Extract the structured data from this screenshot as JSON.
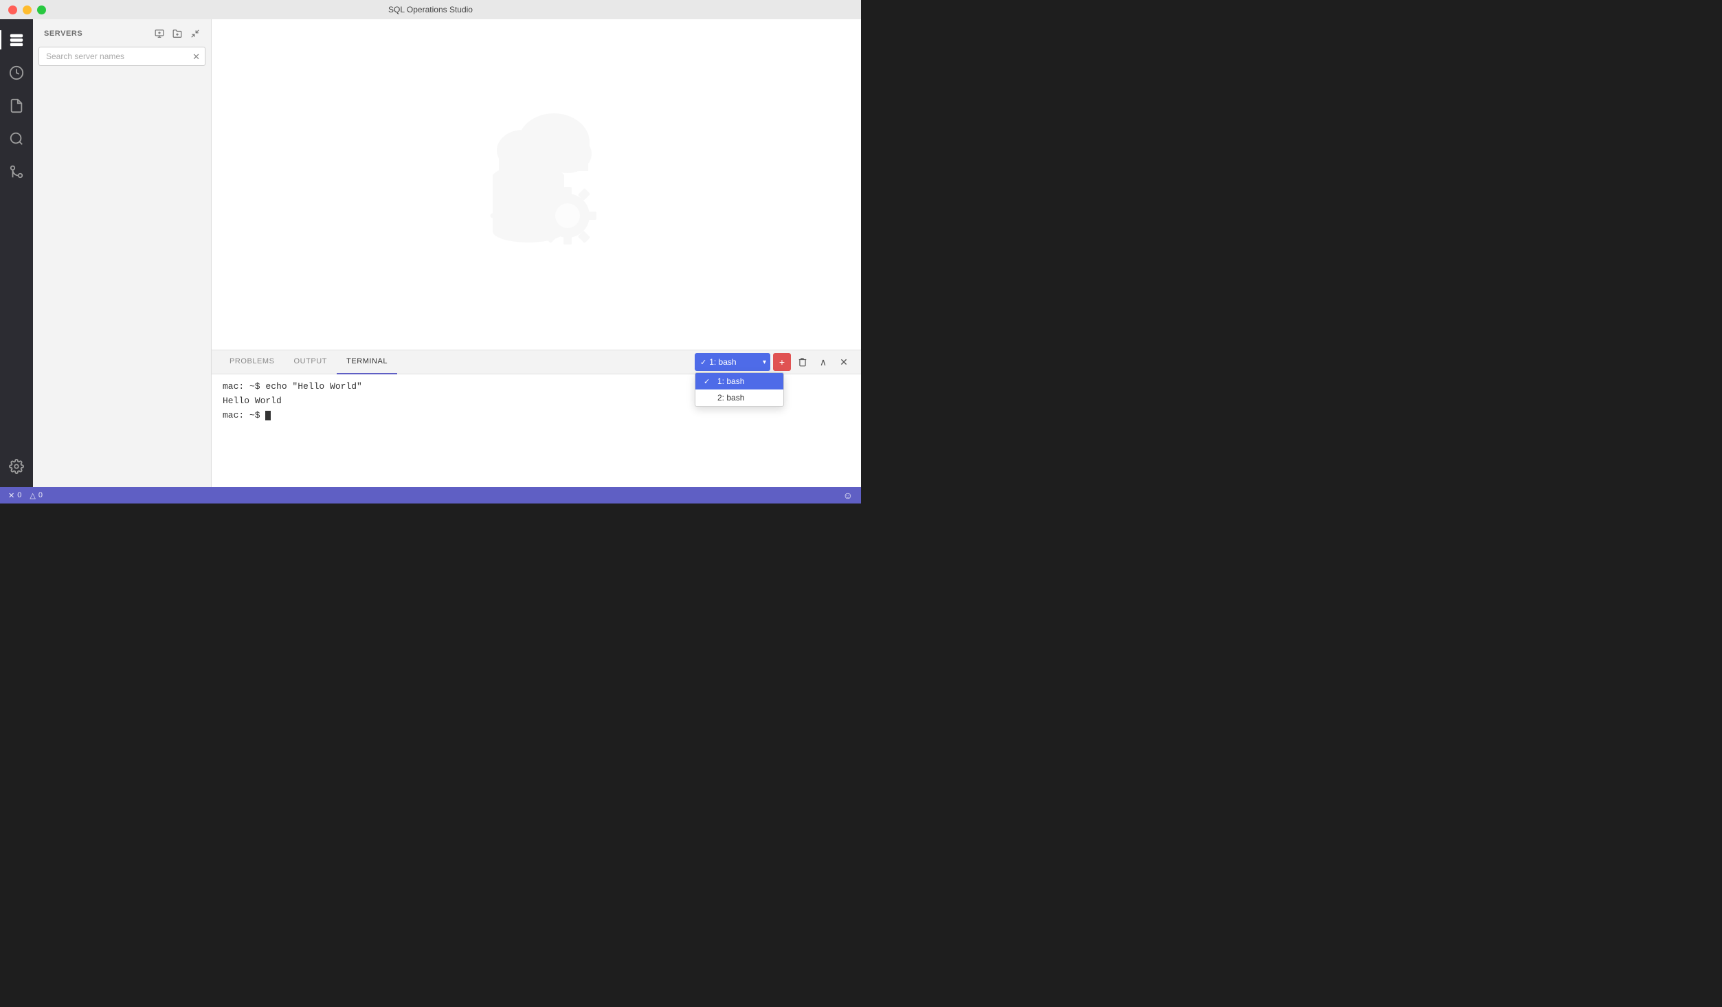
{
  "titlebar": {
    "title": "SQL Operations Studio"
  },
  "activity_bar": {
    "items": [
      {
        "id": "servers",
        "icon": "server-icon",
        "label": "Servers",
        "active": true
      },
      {
        "id": "history",
        "icon": "history-icon",
        "label": "History",
        "active": false
      },
      {
        "id": "file",
        "icon": "file-icon",
        "label": "File",
        "active": false
      },
      {
        "id": "search",
        "icon": "search-icon",
        "label": "Search",
        "active": false
      },
      {
        "id": "git",
        "icon": "git-icon",
        "label": "Source Control",
        "active": false
      }
    ],
    "bottom": [
      {
        "id": "settings",
        "icon": "settings-icon",
        "label": "Settings",
        "active": false
      }
    ]
  },
  "sidebar": {
    "title": "SERVERS",
    "search_placeholder": "Search server names",
    "action_buttons": [
      {
        "id": "new-connection",
        "icon": "new-connection-icon",
        "tooltip": "New Connection"
      },
      {
        "id": "add-server-group",
        "icon": "add-group-icon",
        "tooltip": "Add Server Group"
      },
      {
        "id": "collapse-all",
        "icon": "collapse-icon",
        "tooltip": "Collapse All"
      }
    ]
  },
  "bottom_panel": {
    "tabs": [
      {
        "id": "problems",
        "label": "PROBLEMS",
        "active": false
      },
      {
        "id": "output",
        "label": "OUTPUT",
        "active": false
      },
      {
        "id": "terminal",
        "label": "TERMINAL",
        "active": true
      }
    ],
    "terminal": {
      "sessions": [
        {
          "id": 1,
          "label": "1: bash",
          "selected": true
        },
        {
          "id": 2,
          "label": "2: bash",
          "selected": false
        }
      ],
      "current_session": "1: bash",
      "lines": [
        "mac: ~$ echo \"Hello World\"",
        "Hello World",
        "mac: ~$ "
      ],
      "buttons": {
        "add": "+",
        "delete": "🗑",
        "collapse": "∧",
        "close": "✕"
      }
    }
  },
  "status_bar": {
    "errors": "0",
    "warnings": "0",
    "error_icon": "✕",
    "warning_icon": "△",
    "smiley_icon": "☺"
  }
}
